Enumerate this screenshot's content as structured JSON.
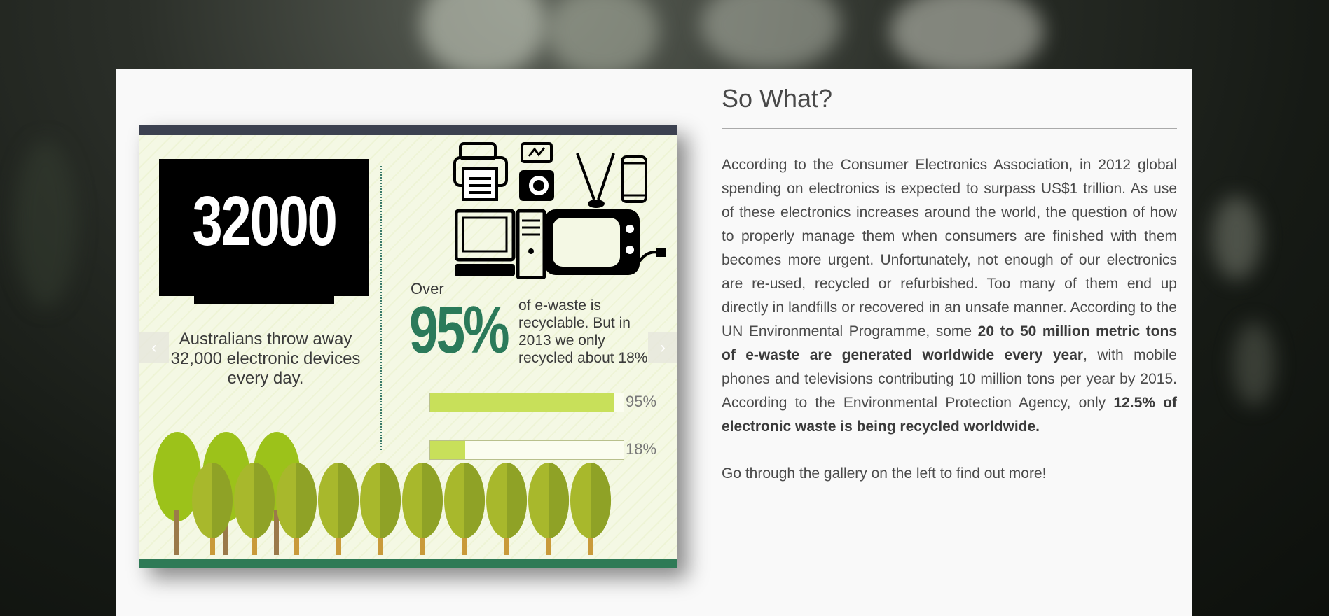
{
  "heading": "So What?",
  "paragraph": {
    "part1": "According to the Consumer Electronics Association, in 2012 global spending on electronics is expected to surpass US$1 trillion. As use of these electronics increases around the world, the question of how to properly manage them when consumers are finished with them becomes more urgent. Unfortunately, not enough of our electronics are re-used, recycled or refurbished. Too many of them end up directly in landfills or recovered in an unsafe manner. According to the UN Environmental Programme, some ",
    "bold1": "20 to 50 million metric tons of e-waste are generated worldwide every year",
    "part2": ", with mobile phones and televisions contributing 10 million tons per year by 2015. According to the Environmental Protection Agency, only ",
    "bold2": "12.5% of electronic waste is being recycled worldwide."
  },
  "gallery_prompt": "Go through the gallery on the left to find out more!",
  "slide": {
    "tv_number": "32000",
    "caption": "Australians throw away 32,000 electronic devices every day.",
    "over": "Over",
    "percent": "95%",
    "percent_text": "of e-waste is recyclable. But in 2013 we only recycled about 18%",
    "bars": [
      {
        "label": "95%",
        "value": 0.95
      },
      {
        "label": "18%",
        "value": 0.18
      }
    ],
    "prev_arrow": "‹",
    "next_arrow": "›"
  },
  "colors": {
    "accent_green": "#2b7a5a",
    "bar_green": "#c8e05a",
    "tree_green": "#9cc21a",
    "panel": "#f9f9f9"
  },
  "icons": [
    "printer-icon",
    "camera-icon",
    "tv-icon",
    "phone-icon",
    "desktop-computer-icon"
  ]
}
